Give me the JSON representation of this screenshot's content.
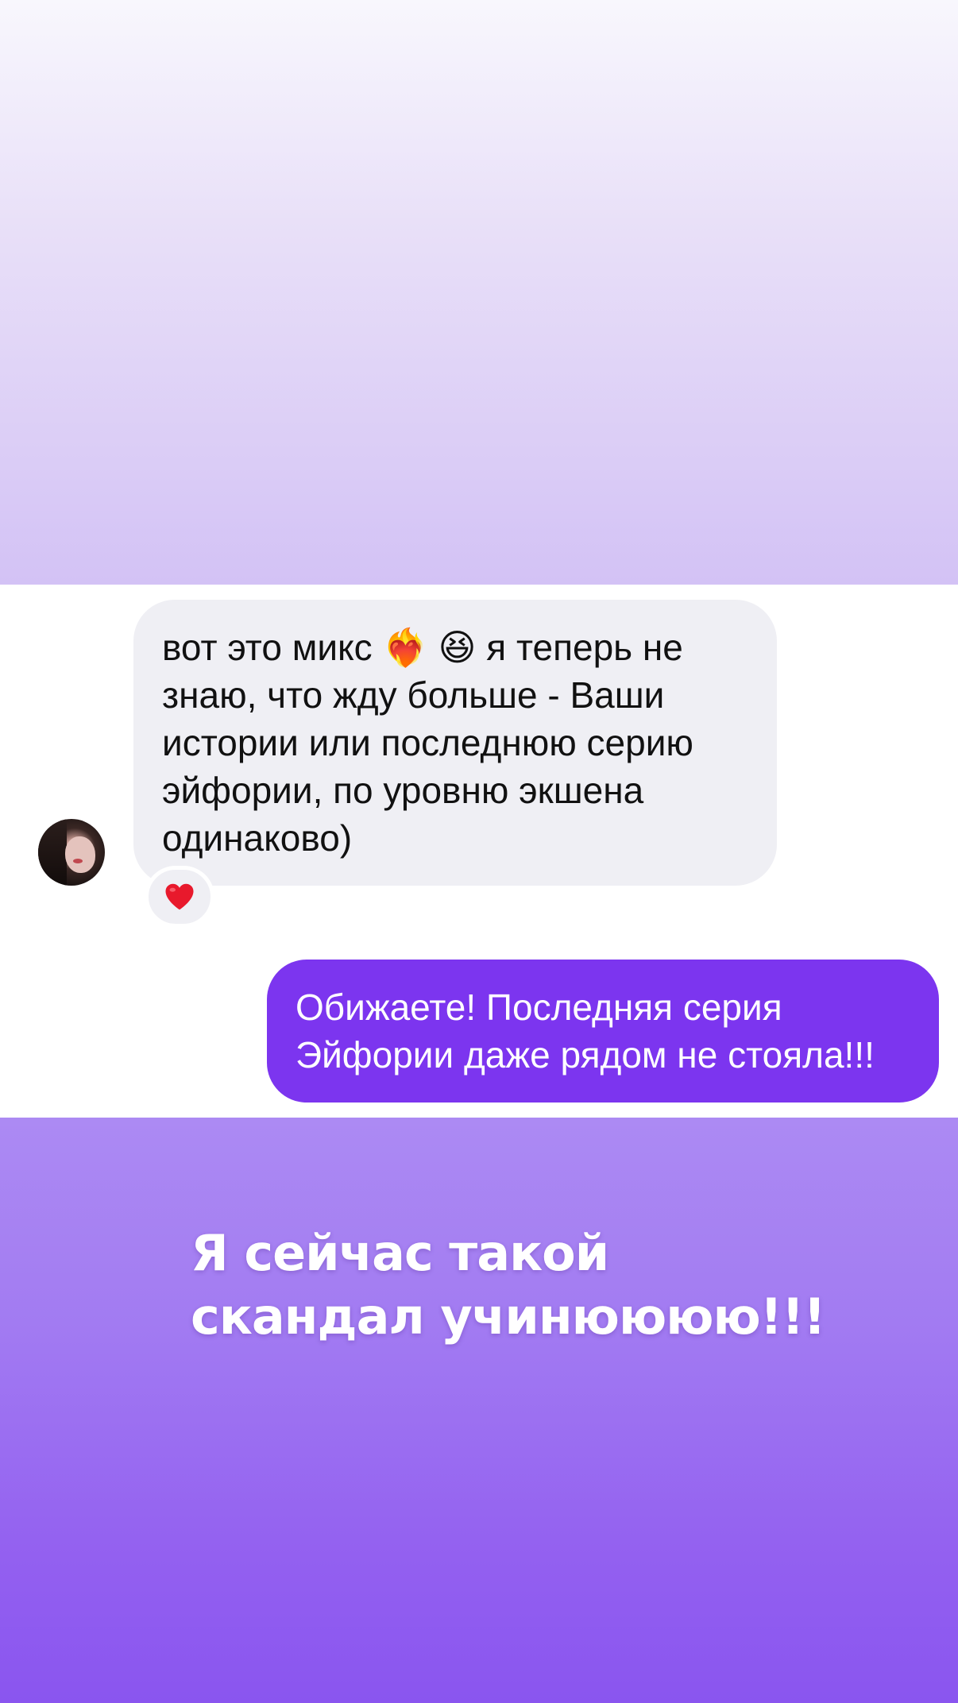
{
  "background": {
    "top_colors": [
      "#f8f7fd",
      "#d3c2f5"
    ],
    "bottom_colors": [
      "#ac8af3",
      "#8a55ef"
    ]
  },
  "incoming_message": {
    "text": "вот это микс ❤️‍🔥 😆 я теперь не\nзнаю, что жду больше - Ваши\nистории или последнюю серию\nэйфории, по уровню экшена\nодинаково)",
    "bubble_color": "#efeff4",
    "reaction": "heart-icon",
    "reaction_color": "#e8192c"
  },
  "outgoing_message": {
    "text": "Обижаете! Последняя серия\nЭйфории даже рядом не стояла!!!",
    "bubble_color": "#7c35ef"
  },
  "caption": {
    "text": "Я сейчас такой\nскандал учинюююю!!!"
  }
}
